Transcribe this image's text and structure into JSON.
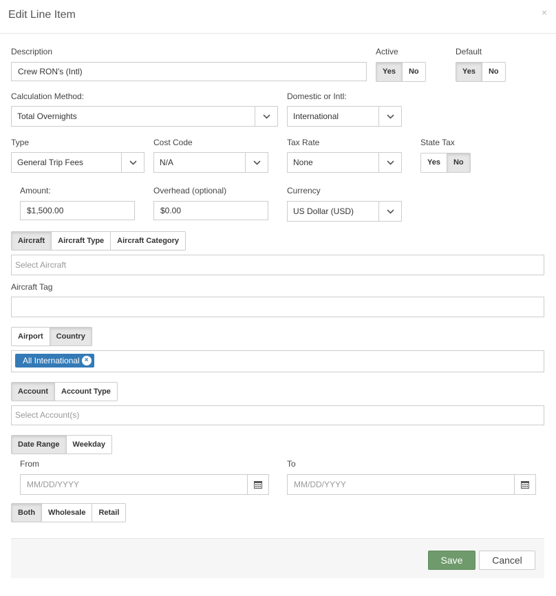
{
  "modal": {
    "title": "Edit Line Item",
    "close": "×"
  },
  "form": {
    "description": {
      "label": "Description",
      "value": "Crew RON's (Intl)"
    },
    "active": {
      "label": "Active",
      "yes": "Yes",
      "no": "No",
      "selected": "Yes"
    },
    "default": {
      "label": "Default",
      "yes": "Yes",
      "no": "No",
      "selected": "Yes"
    },
    "calculation_method": {
      "label": "Calculation Method:",
      "value": "Total Overnights"
    },
    "domestic_intl": {
      "label": "Domestic or Intl:",
      "value": "International"
    },
    "type": {
      "label": "Type",
      "value": "General Trip Fees"
    },
    "cost_code": {
      "label": "Cost Code",
      "value": "N/A"
    },
    "tax_rate": {
      "label": "Tax Rate",
      "value": "None"
    },
    "state_tax": {
      "label": "State Tax",
      "yes": "Yes",
      "no": "No",
      "selected": "No"
    },
    "amount": {
      "label": "Amount:",
      "value": "$1,500.00"
    },
    "overhead": {
      "label": "Overhead (optional)",
      "value": "$0.00"
    },
    "currency": {
      "label": "Currency",
      "value": "US Dollar (USD)"
    },
    "aircraft_tabs": {
      "aircraft": "Aircraft",
      "aircraft_type": "Aircraft Type",
      "aircraft_category": "Aircraft Category",
      "selected": "Aircraft"
    },
    "aircraft_select": {
      "placeholder": "Select Aircraft"
    },
    "aircraft_tag": {
      "label": "Aircraft Tag",
      "value": ""
    },
    "location_tabs": {
      "airport": "Airport",
      "country": "Country",
      "selected": "Country"
    },
    "country_tags": [
      "All International"
    ],
    "account_tabs": {
      "account": "Account",
      "account_type": "Account Type",
      "selected": "Account"
    },
    "account_select": {
      "placeholder": "Select Account(s)"
    },
    "date_tabs": {
      "date_range": "Date Range",
      "weekday": "Weekday",
      "selected": "Date Range"
    },
    "from": {
      "label": "From",
      "placeholder": "MM/DD/YYYY"
    },
    "to": {
      "label": "To",
      "placeholder": "MM/DD/YYYY"
    },
    "sale_tabs": {
      "both": "Both",
      "wholesale": "Wholesale",
      "retail": "Retail",
      "selected": "Both"
    }
  },
  "footer": {
    "save": "Save",
    "cancel": "Cancel"
  },
  "colors": {
    "save": "#6f9a6b",
    "tag": "#337ab7",
    "active_toggle": "#e6e6e6"
  },
  "icons": {
    "dropdown": "chevron-down-icon",
    "calendar": "calendar-icon",
    "close": "close-icon",
    "tag_remove": "remove-tag-icon"
  }
}
